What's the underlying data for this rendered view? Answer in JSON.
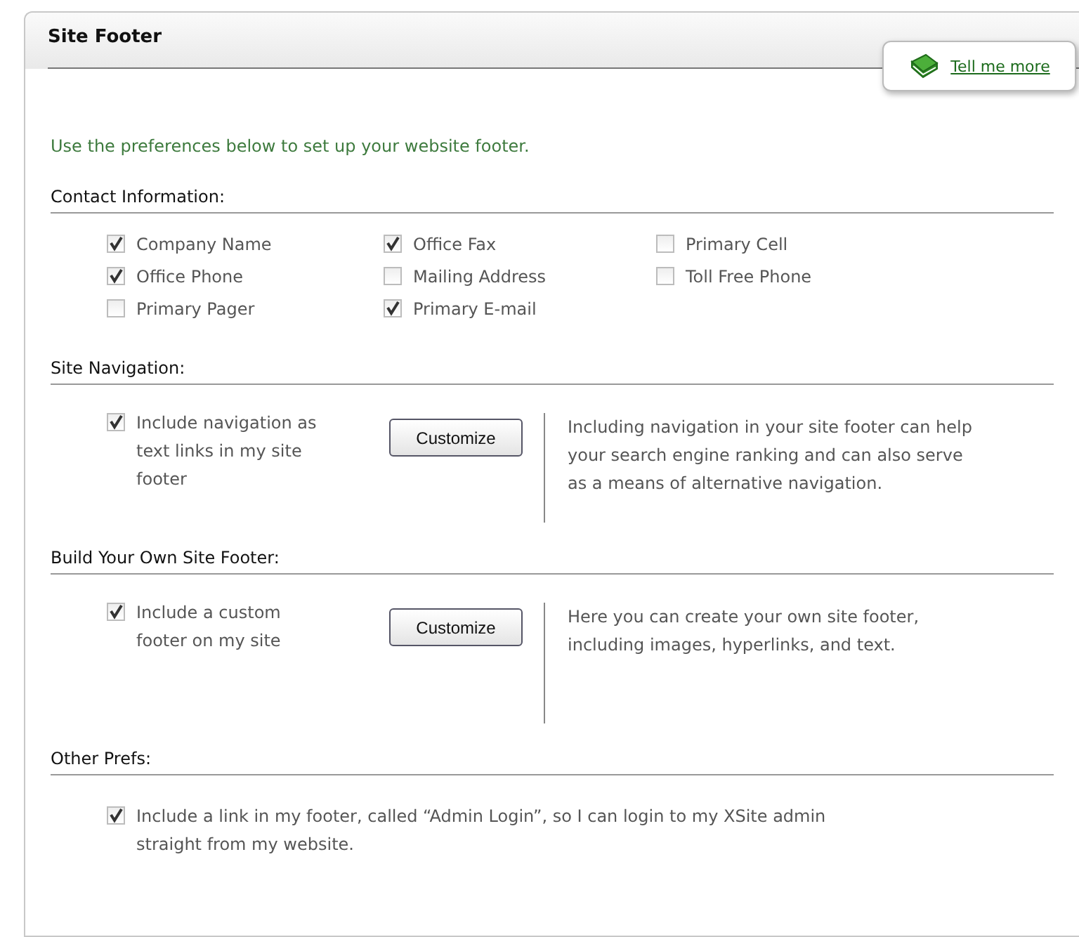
{
  "panel": {
    "title": "Site Footer",
    "help_link": "Tell me more"
  },
  "intro": "Use the preferences below to set up your website footer.",
  "contact": {
    "heading": "Contact Information:",
    "options": [
      {
        "label": "Company Name",
        "checked": true
      },
      {
        "label": "Office Fax",
        "checked": true
      },
      {
        "label": "Primary Cell",
        "checked": false
      },
      {
        "label": "Office Phone",
        "checked": true
      },
      {
        "label": "Mailing Address",
        "checked": false
      },
      {
        "label": "Toll Free Phone",
        "checked": false
      },
      {
        "label": "Primary Pager",
        "checked": false
      },
      {
        "label": "Primary E-mail",
        "checked": true
      }
    ]
  },
  "navigation": {
    "heading": "Site Navigation:",
    "option": {
      "label": "Include navigation as text links in my site footer",
      "checked": true
    },
    "button": "Customize",
    "description": "Including navigation in your site footer can help your search engine ranking and can also serve as a means of alternative navigation."
  },
  "custom_footer": {
    "heading": "Build Your Own Site Footer:",
    "option": {
      "label": "Include a custom footer on my site",
      "checked": true
    },
    "button": "Customize",
    "description": "Here you can create your own site footer, including images, hyperlinks, and text."
  },
  "other": {
    "heading": "Other Prefs:",
    "option": {
      "label": "Include a link in my footer, called “Admin Login”, so I can login to my XSite admin straight from my website.",
      "checked": true
    }
  }
}
